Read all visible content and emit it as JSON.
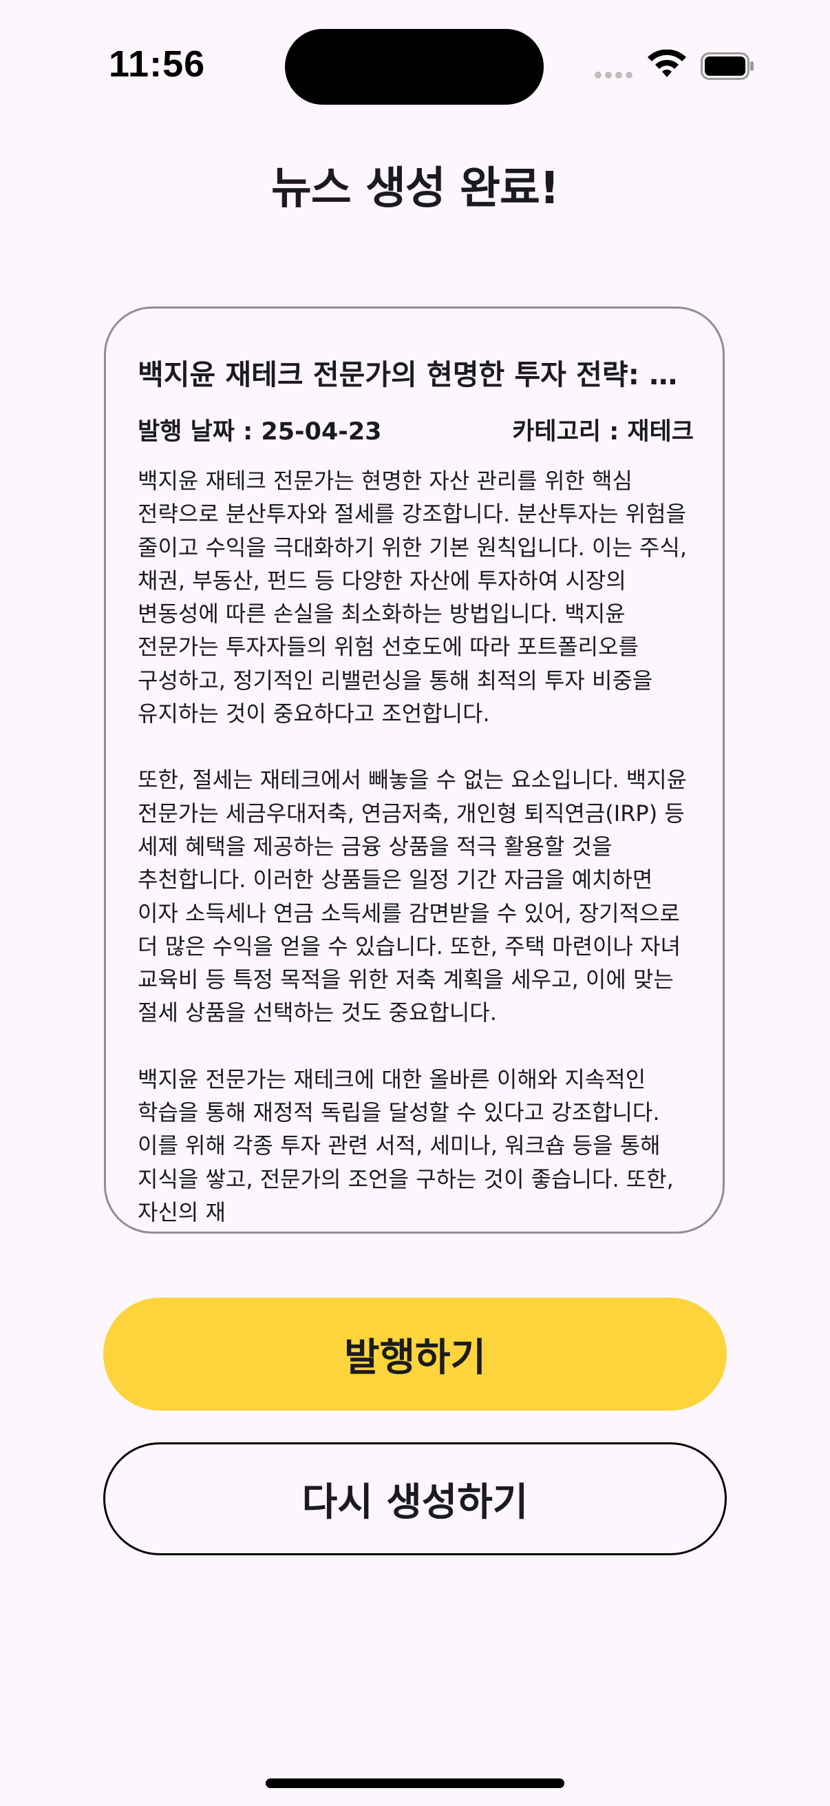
{
  "status_bar": {
    "time": "11:56"
  },
  "header": {
    "title": "뉴스 생성 완료!"
  },
  "article": {
    "title": "백지윤 재테크 전문가의 현명한 투자 전략: 분산투자와 절세",
    "publish_date": "발행 날짜 : 25-04-23",
    "category": "카테고리 : 재테크",
    "paragraphs": [
      "백지윤 재테크 전문가는 현명한 자산 관리를 위한 핵심 전략으로 분산투자와 절세를 강조합니다. 분산투자는 위험을 줄이고 수익을 극대화하기 위한 기본 원칙입니다. 이는 주식, 채권, 부동산, 펀드 등 다양한 자산에 투자하여 시장의 변동성에 따른 손실을 최소화하는 방법입니다. 백지윤 전문가는 투자자들의 위험 선호도에 따라 포트폴리오를 구성하고, 정기적인 리밸런싱을 통해 최적의 투자 비중을 유지하는 것이 중요하다고 조언합니다.",
      "또한, 절세는 재테크에서 빼놓을 수 없는 요소입니다. 백지윤 전문가는 세금우대저축, 연금저축, 개인형 퇴직연금(IRP) 등 세제 혜택을 제공하는 금융 상품을 적극 활용할 것을 추천합니다. 이러한 상품들은 일정 기간 자금을 예치하면 이자 소득세나 연금 소득세를 감면받을 수 있어, 장기적으로 더 많은 수익을 얻을 수 있습니다. 또한, 주택 마련이나 자녀 교육비 등 특정 목적을 위한 저축 계획을 세우고, 이에 맞는 절세 상품을 선택하는 것도 중요합니다.",
      "백지윤 전문가는 재테크에 대한 올바른 이해와 지속적인 학습을 통해 재정적 독립을 달성할 수 있다고 강조합니다. 이를 위해 각종 투자 관련 서적, 세미나, 워크숍 등을 통해 지식을 쌓고, 전문가의 조언을 구하는 것이 좋습니다. 또한, 자신의 재"
    ]
  },
  "actions": {
    "publish_label": "발행하기",
    "regenerate_label": "다시 생성하기"
  },
  "colors": {
    "background": "#fdf7fd",
    "publish_button": "#fdd43c",
    "card_border": "#8f8f93"
  },
  "icons": [
    "signal-icon",
    "wifi-icon",
    "battery-icon"
  ]
}
